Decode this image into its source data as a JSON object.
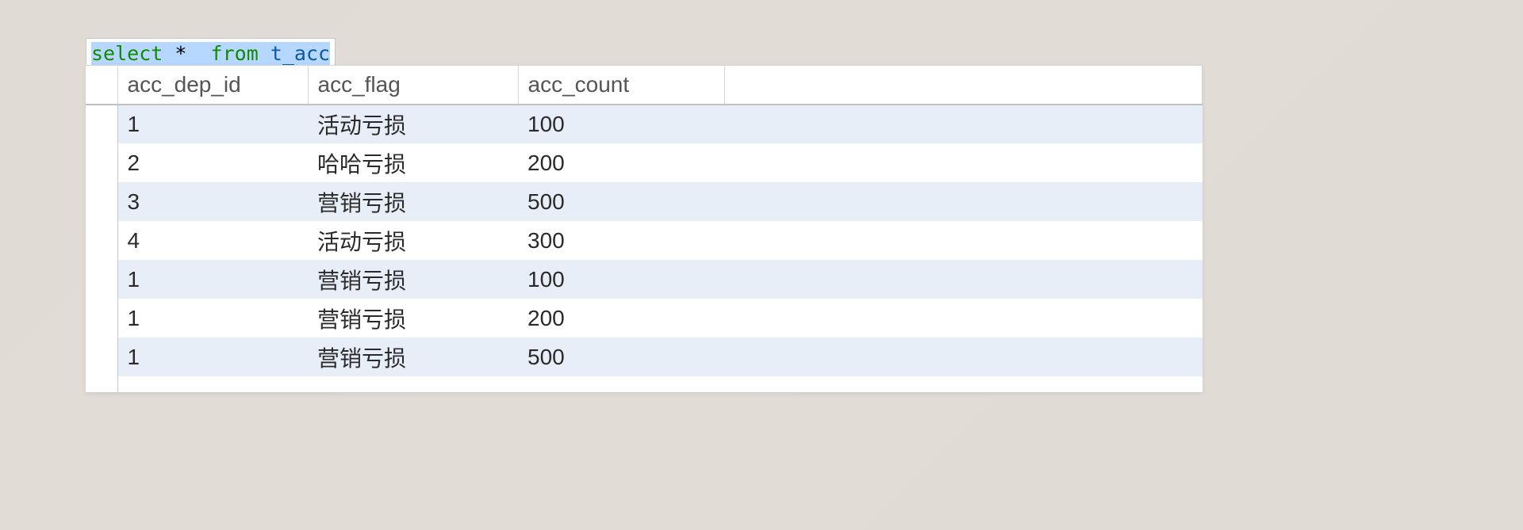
{
  "sql": {
    "select": "select",
    "star": "*",
    "from": "from",
    "table": "t_acc"
  },
  "table": {
    "columns": [
      "acc_dep_id",
      "acc_flag",
      "acc_count"
    ],
    "rows": [
      {
        "acc_dep_id": "1",
        "acc_flag": "活动亏损",
        "acc_count": "100"
      },
      {
        "acc_dep_id": "2",
        "acc_flag": "哈哈亏损",
        "acc_count": "200"
      },
      {
        "acc_dep_id": "3",
        "acc_flag": "营销亏损",
        "acc_count": "500"
      },
      {
        "acc_dep_id": "4",
        "acc_flag": "活动亏损",
        "acc_count": "300"
      },
      {
        "acc_dep_id": "1",
        "acc_flag": "营销亏损",
        "acc_count": "100"
      },
      {
        "acc_dep_id": "1",
        "acc_flag": "营销亏损",
        "acc_count": "200"
      },
      {
        "acc_dep_id": "1",
        "acc_flag": "营销亏损",
        "acc_count": "500"
      }
    ]
  }
}
